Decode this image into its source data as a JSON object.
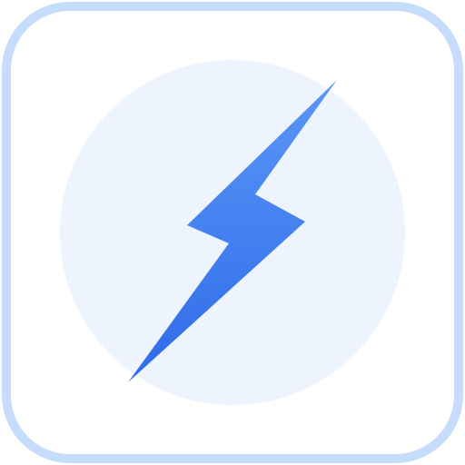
{
  "icon": {
    "name": "lightning-bolt-icon",
    "frame_border_color": "#C5DCFB",
    "frame_fill_color": "#FFFFFF",
    "circle_color": "#EEF4FE",
    "bolt_color_top": "#5B97F6",
    "bolt_color_bottom": "#2E6BEA"
  }
}
